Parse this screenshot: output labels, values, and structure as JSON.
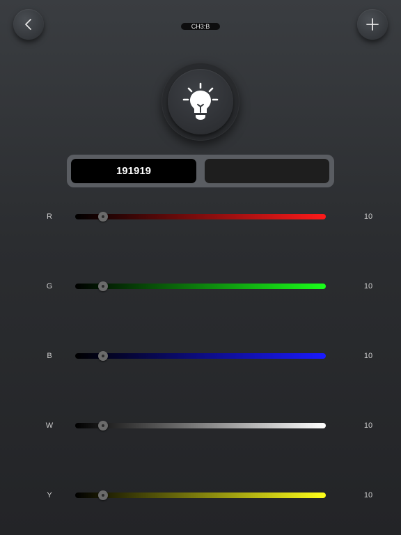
{
  "header": {
    "channel_label": "CH3:B",
    "back_icon": "chevron-left-icon",
    "add_icon": "plus-icon"
  },
  "lamp": {
    "icon": "light-bulb-icon"
  },
  "color_display": {
    "hex_value": "191919",
    "swatch_color": "#1e1e1e"
  },
  "channels": [
    {
      "label": "R",
      "value": "10",
      "level": 0.1,
      "track_color": "#ff1a1a"
    },
    {
      "label": "G",
      "value": "10",
      "level": 0.1,
      "track_color": "#1aff1a"
    },
    {
      "label": "B",
      "value": "10",
      "level": 0.1,
      "track_color": "#1a1aff"
    },
    {
      "label": "W",
      "value": "10",
      "level": 0.1,
      "track_color": "#ffffff"
    },
    {
      "label": "Y",
      "value": "10",
      "level": 0.1,
      "track_color": "#ffff1a"
    }
  ]
}
